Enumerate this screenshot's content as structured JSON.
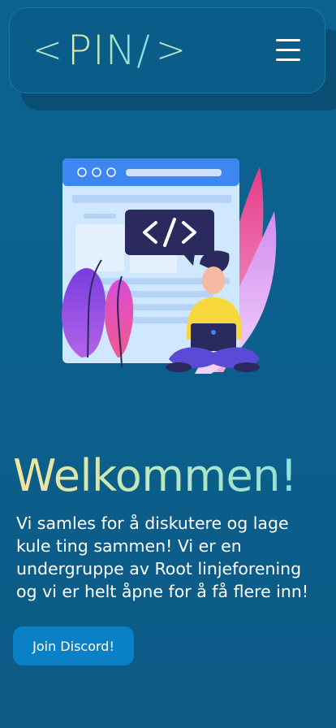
{
  "nav": {
    "logo_open": "<",
    "logo_text": "PIN/",
    "logo_close": ">",
    "menu_icon": "hamburger-menu-icon"
  },
  "hero": {
    "illustration": "developer-coding-illustration",
    "title": "Welkommen!",
    "text": "Vi samles for å diskutere og lage kule ting sammen! Vi er en undergruppe av Root linjeforening og vi er helt åpne for å få flere inn!",
    "cta_label": "Join Discord!"
  },
  "colors": {
    "background": "#0b6390",
    "nav": "#0a5d88",
    "cta": "#0a80c6",
    "title_gradient_start": "#f4e59a",
    "title_gradient_end": "#8fe0d8"
  }
}
